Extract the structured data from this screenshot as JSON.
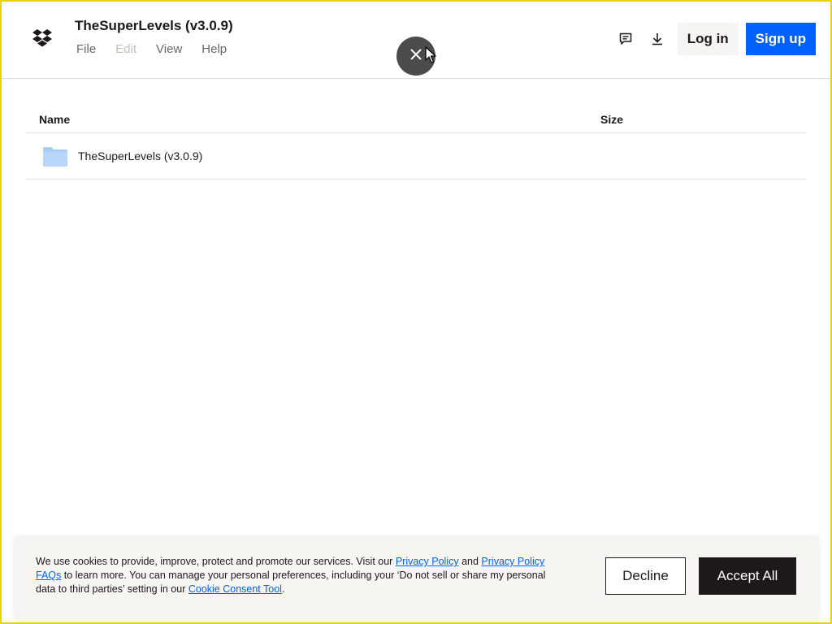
{
  "header": {
    "title": "TheSuperLevels (v3.0.9)",
    "menu": [
      {
        "label": "File",
        "disabled": false
      },
      {
        "label": "Edit",
        "disabled": true
      },
      {
        "label": "View",
        "disabled": false
      },
      {
        "label": "Help",
        "disabled": false
      }
    ],
    "login_label": "Log in",
    "signup_label": "Sign up",
    "icons": [
      "dropbox-logo-icon",
      "comment-icon",
      "download-icon"
    ]
  },
  "overlay": {
    "close_icon": "close-icon"
  },
  "table": {
    "columns": [
      "Name",
      "Size"
    ],
    "rows": [
      {
        "name": "TheSuperLevels (v3.0.9)",
        "size": "",
        "icon": "folder-icon"
      }
    ]
  },
  "cookie_banner": {
    "text_part1": "We use cookies to provide, improve, protect and promote our services. Visit our ",
    "link_privacy_policy": "Privacy Policy",
    "text_part2": " and ",
    "link_privacy_faqs": "Privacy Policy FAQs",
    "text_part3": " to learn more. You can manage your personal preferences, including your ‘Do not sell or share my personal data to third parties’ setting in our ",
    "link_consent_tool": "Cookie Consent Tool",
    "text_part4": ".",
    "decline_label": "Decline",
    "accept_label": "Accept All"
  },
  "colors": {
    "brand_blue": "#0061fe",
    "frame_yellow": "#e8d20f",
    "dark": "#1e1919",
    "folder": "#a8cdf7"
  }
}
